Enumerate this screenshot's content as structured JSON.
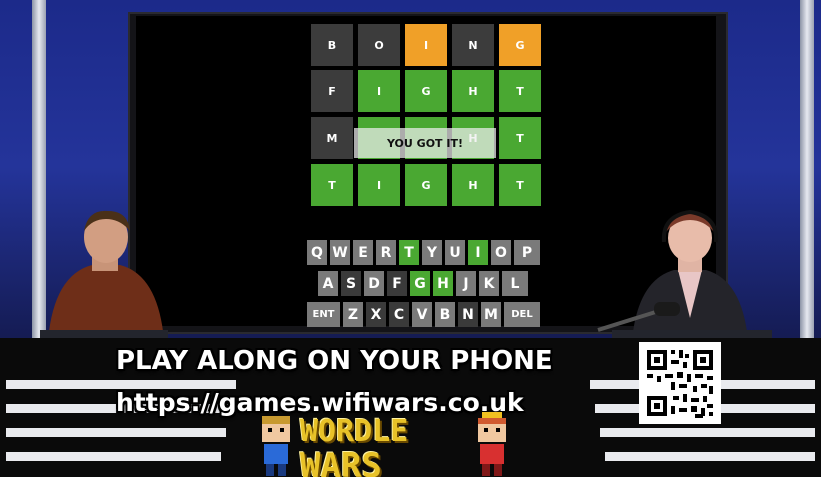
{
  "board": {
    "rows": [
      [
        "B",
        "O",
        "I",
        "N",
        "G"
      ],
      [
        "F",
        "I",
        "G",
        "H",
        "T"
      ],
      [
        "M",
        "",
        "",
        "H",
        "T"
      ],
      [
        "T",
        "I",
        "G",
        "H",
        "T"
      ]
    ],
    "toast": "YOU GOT IT!"
  },
  "keyboard": {
    "row1": [
      "Q",
      "W",
      "E",
      "R",
      "T",
      "Y",
      "U",
      "I",
      "O",
      "P"
    ],
    "row2": [
      "A",
      "S",
      "D",
      "F",
      "G",
      "H",
      "J",
      "K",
      "L"
    ],
    "row3": [
      "ENT",
      "Z",
      "X",
      "C",
      "V",
      "B",
      "N",
      "M",
      "DEL"
    ]
  },
  "banner": {
    "line1": "PLAY ALONG ON YOUR PHONE",
    "line2": "https://games.wifiwars.co.uk"
  },
  "logo": {
    "line1": "WORDLE",
    "line2": "WARS"
  },
  "colors": {
    "correct": "#4aa832",
    "present": "#f0a028",
    "absent": "#3c3c3c"
  }
}
